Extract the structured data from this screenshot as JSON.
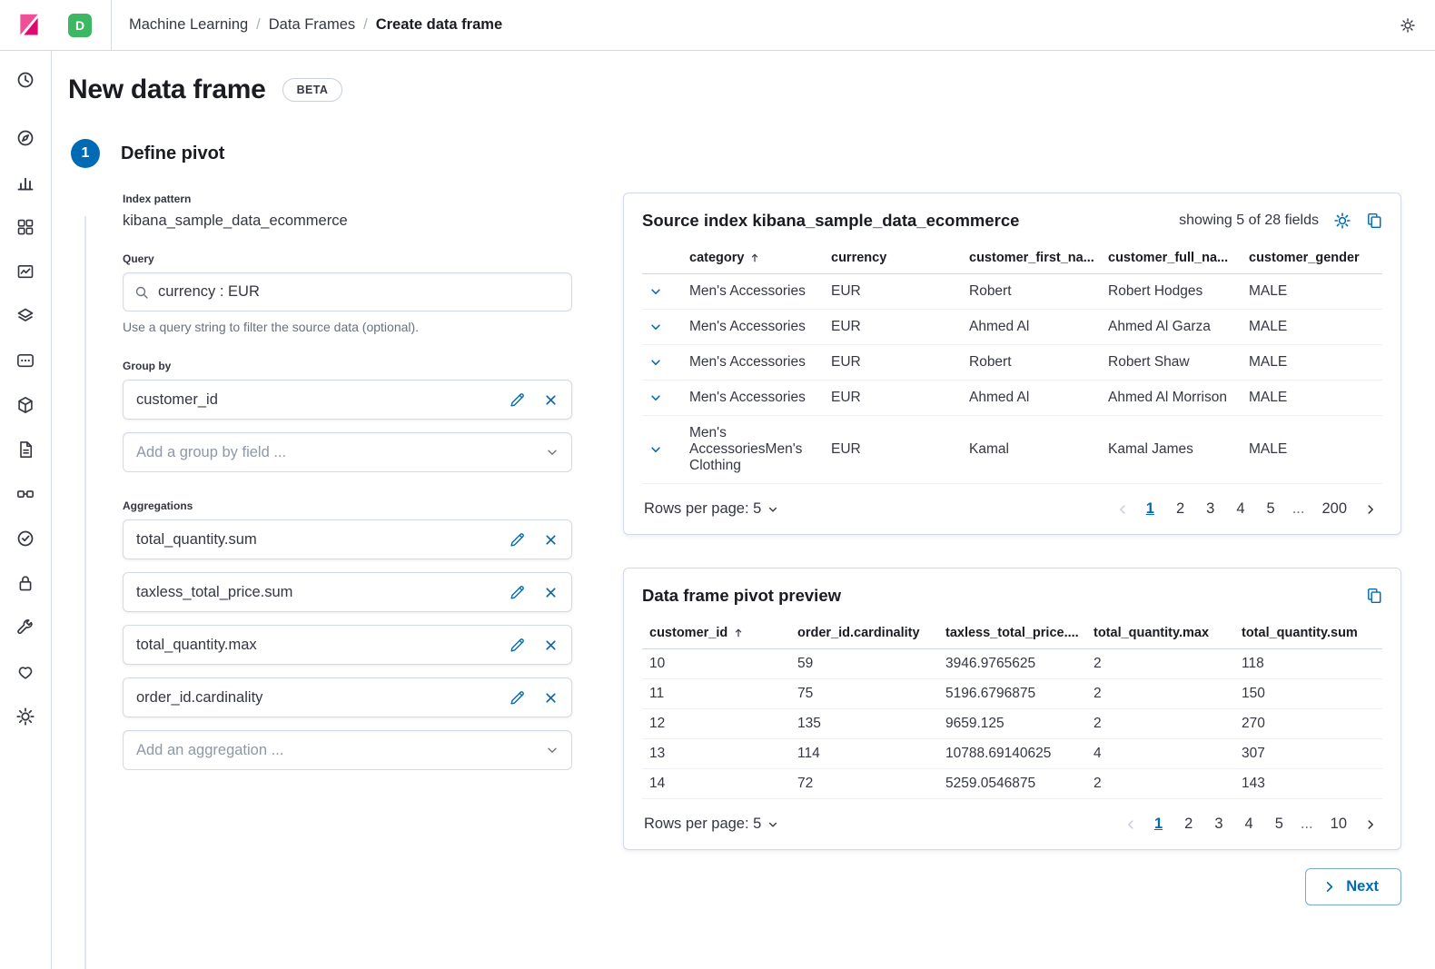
{
  "colors": {
    "primary": "#006BB4",
    "accent_pink": "#F04E98",
    "accent_pink_dark": "#DD0A73",
    "space_badge_green": "#3DB862",
    "border": "#D3DAE6",
    "text": "#343741",
    "subdued": "#69707D"
  },
  "icons": {
    "search-icon": "⌕",
    "edit-pencil-icon": "✎",
    "remove-x-icon": "✕",
    "chevron-down-icon": "⌄",
    "chevron-left-icon": "‹",
    "chevron-right-icon": "›",
    "sort-asc-icon": "↑",
    "gear-icon": "⚙",
    "copy-clipboard-icon": "⧉",
    "row-expand-icon": "⌄"
  },
  "header": {
    "space_badge": "D",
    "breadcrumbs": {
      "items": [
        "Machine Learning",
        "Data Frames",
        "Create data frame"
      ],
      "separator": "/"
    }
  },
  "page": {
    "title": "New data frame",
    "beta_badge": "BETA",
    "step_number": "1",
    "step_title": "Define pivot"
  },
  "form": {
    "index_pattern_label": "Index pattern",
    "index_pattern_value": "kibana_sample_data_ecommerce",
    "query_label": "Query",
    "query_value": "currency : EUR",
    "query_help": "Use a query string to filter the source data (optional).",
    "group_by_label": "Group by",
    "group_by_items": [
      "customer_id"
    ],
    "group_by_placeholder": "Add a group by field ...",
    "aggregations_label": "Aggregations",
    "aggregation_items": [
      "total_quantity.sum",
      "taxless_total_price.sum",
      "total_quantity.max",
      "order_id.cardinality"
    ],
    "aggregation_placeholder": "Add an aggregation ..."
  },
  "source_panel": {
    "title": "Source index kibana_sample_data_ecommerce",
    "fields_info": "showing 5 of 28 fields",
    "columns": [
      "category",
      "currency",
      "customer_first_na...",
      "customer_full_na...",
      "customer_gender"
    ],
    "rows": [
      [
        "Men's Accessories",
        "EUR",
        "Robert",
        "Robert Hodges",
        "MALE"
      ],
      [
        "Men's Accessories",
        "EUR",
        "Ahmed Al",
        "Ahmed Al Garza",
        "MALE"
      ],
      [
        "Men's Accessories",
        "EUR",
        "Robert",
        "Robert Shaw",
        "MALE"
      ],
      [
        "Men's Accessories",
        "EUR",
        "Ahmed Al",
        "Ahmed Al Morrison",
        "MALE"
      ],
      [
        "Men's AccessoriesMen's Clothing",
        "EUR",
        "Kamal",
        "Kamal James",
        "MALE"
      ]
    ],
    "rows_per_page": "Rows per page: 5",
    "pages": [
      "1",
      "2",
      "3",
      "4",
      "5",
      "...",
      "200"
    ],
    "active_page": "1"
  },
  "preview_panel": {
    "title": "Data frame pivot preview",
    "columns": [
      "customer_id",
      "order_id.cardinality",
      "taxless_total_price....",
      "total_quantity.max",
      "total_quantity.sum"
    ],
    "rows": [
      [
        "10",
        "59",
        "3946.9765625",
        "2",
        "118"
      ],
      [
        "11",
        "75",
        "5196.6796875",
        "2",
        "150"
      ],
      [
        "12",
        "135",
        "9659.125",
        "2",
        "270"
      ],
      [
        "13",
        "114",
        "10788.69140625",
        "4",
        "307"
      ],
      [
        "14",
        "72",
        "5259.0546875",
        "2",
        "143"
      ]
    ],
    "rows_per_page": "Rows per page: 5",
    "pages": [
      "1",
      "2",
      "3",
      "4",
      "5",
      "...",
      "10"
    ],
    "active_page": "1"
  },
  "next_button": {
    "label": "Next"
  }
}
